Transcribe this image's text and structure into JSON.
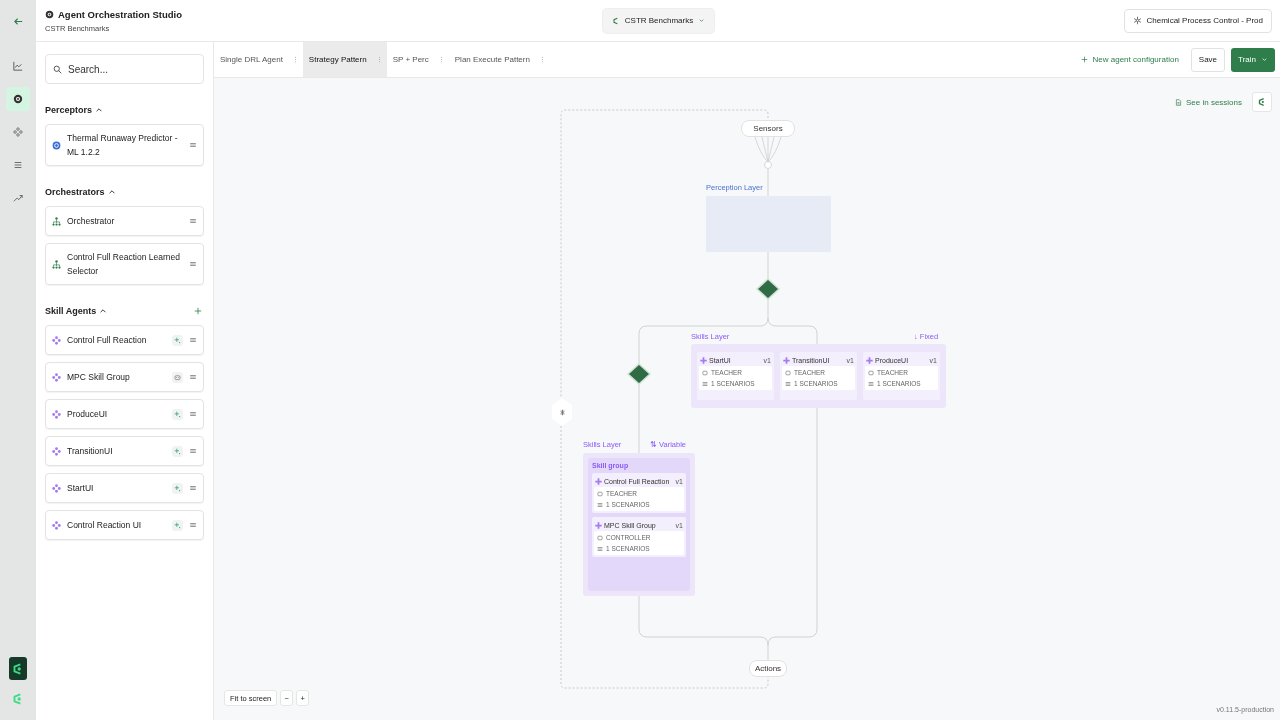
{
  "header": {
    "title": "Agent Orchestration Studio",
    "subtitle": "CSTR Benchmarks",
    "project": "CSTR Benchmarks",
    "environment": "Chemical Process Control - Prod"
  },
  "rail": [
    {
      "kind": "chart",
      "selected": false
    },
    {
      "kind": "agent",
      "selected": true
    },
    {
      "kind": "nodes",
      "selected": false
    },
    {
      "kind": "list",
      "selected": false
    },
    {
      "kind": "trend",
      "selected": false
    }
  ],
  "sidebar": {
    "search": {
      "placeholder": "Search..."
    },
    "sections": [
      {
        "title": "Perceptors",
        "expanded": true,
        "can_add": false,
        "items": [
          {
            "label": "Thermal Runaway Predictor - ML 1.2.2",
            "kind": "perceptor"
          }
        ]
      },
      {
        "title": "Orchestrators",
        "expanded": true,
        "can_add": false,
        "items": [
          {
            "label": "Orchestrator",
            "kind": "orchestrator"
          },
          {
            "label": "Control Full Reaction Learned Selector",
            "kind": "orchestrator"
          }
        ]
      },
      {
        "title": "Skill Agents",
        "expanded": true,
        "can_add": true,
        "items": [
          {
            "label": "Control Full Reaction",
            "kind": "skill",
            "badge": {
              "kind": "learned"
            }
          },
          {
            "label": "MPC Skill Group",
            "kind": "skill",
            "badge": {
              "kind": "controller"
            }
          },
          {
            "label": "ProduceUI",
            "kind": "skill",
            "badge": {
              "kind": "learned"
            }
          },
          {
            "label": "TransitionUI",
            "kind": "skill",
            "badge": {
              "kind": "learned"
            }
          },
          {
            "label": "StartUI",
            "kind": "skill",
            "badge": {
              "kind": "learned"
            }
          },
          {
            "label": "Control Reaction UI",
            "kind": "skill",
            "badge": {
              "kind": "learned"
            }
          }
        ]
      }
    ]
  },
  "tabs": [
    {
      "label": "Single DRL Agent",
      "selected": false
    },
    {
      "label": "Strategy Pattern",
      "selected": true
    },
    {
      "label": "SP + Perc",
      "selected": false
    },
    {
      "label": "Plan Execute Pattern",
      "selected": false
    }
  ],
  "toolbar": {
    "new_config": "New agent configuration",
    "save": "Save",
    "train": "Train"
  },
  "canvas": {
    "see_sessions": "See in sessions",
    "sensors": "Sensors",
    "perception_label": "Perception Layer",
    "fixed_layer": {
      "label": "Skills Layer",
      "mode": "↓ Fixed",
      "skills": [
        {
          "name": "StartUI",
          "version": "v1",
          "role": "TEACHER",
          "scenarios": "1 SCENARIOS"
        },
        {
          "name": "TransitionUI",
          "version": "v1",
          "role": "TEACHER",
          "scenarios": "1 SCENARIOS"
        },
        {
          "name": "ProduceUI",
          "version": "v1",
          "role": "TEACHER",
          "scenarios": "1 SCENARIOS"
        }
      ]
    },
    "variable_layer": {
      "label": "Skills Layer",
      "mode": "⇅ Variable",
      "group": "Skill group",
      "skills": [
        {
          "name": "Control Full Reaction",
          "version": "v1",
          "role": "TEACHER",
          "scenarios": "1 SCENARIOS"
        },
        {
          "name": "MPC Skill Group",
          "version": "v1",
          "role": "CONTROLLER",
          "scenarios": "1 SCENARIOS"
        }
      ]
    },
    "actions": "Actions",
    "fit": "Fit to screen",
    "zoom_out": "−",
    "zoom_in": "+",
    "version": "v0.11.5-production"
  }
}
